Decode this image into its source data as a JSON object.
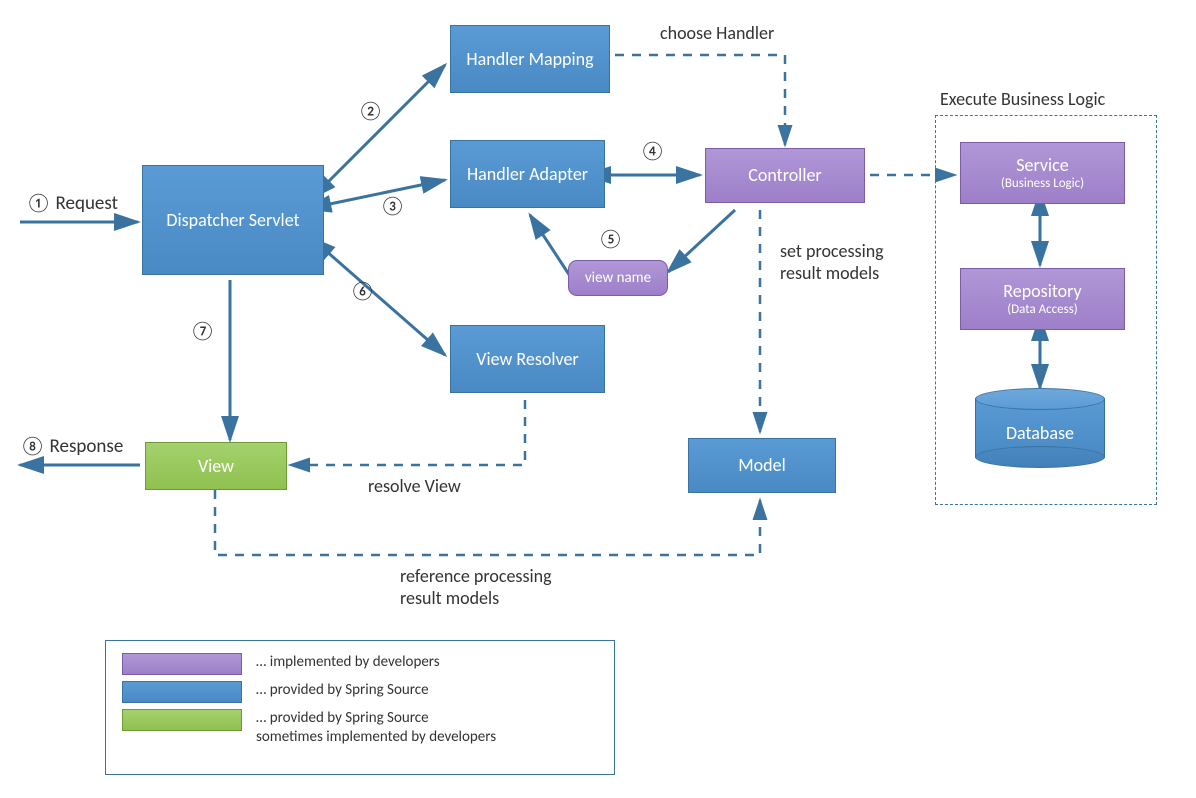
{
  "boxes": {
    "dispatcher": "Dispatcher Servlet",
    "handler_mapping": "Handler Mapping",
    "handler_adapter": "Handler Adapter",
    "view_resolver": "View Resolver",
    "model": "Model",
    "controller": "Controller",
    "view_name": "view name",
    "service_line1": "Service",
    "service_line2": "(Business Logic)",
    "repository_line1": "Repository",
    "repository_line2": "(Data Access)",
    "view": "View",
    "database": "Database"
  },
  "labels": {
    "request": "Request",
    "response": "Response",
    "choose_handler": "choose Handler",
    "set_models_l1": "set processing",
    "set_models_l2": "result models",
    "ref_models_l1": "reference processing",
    "ref_models_l2": "result models",
    "resolve_view": "resolve View",
    "exec_biz": "Execute Business Logic"
  },
  "steps": {
    "s1": "①",
    "s2": "②",
    "s3": "③",
    "s4": "④",
    "s5": "⑤",
    "s6": "⑥",
    "s7": "⑦",
    "s8": "⑧"
  },
  "legend": {
    "purple": "… implemented by developers",
    "blue": "… provided by Spring Source",
    "green_l1": "… provided by Spring Source",
    "green_l2": "sometimes implemented by developers"
  }
}
